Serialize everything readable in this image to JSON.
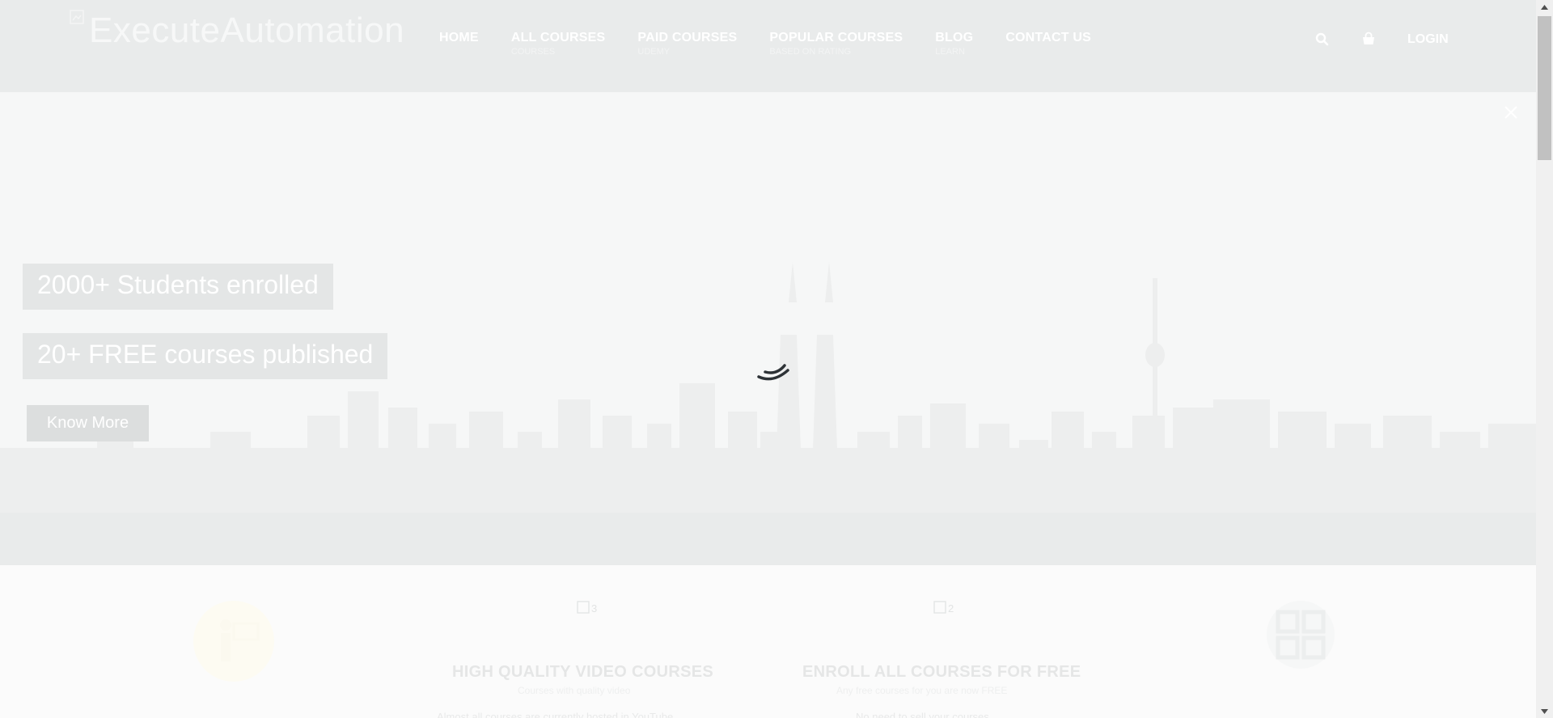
{
  "header": {
    "logo_text": "ExecuteAutomation",
    "nav": [
      {
        "label": "HOME",
        "sub": ""
      },
      {
        "label": "ALL COURSES",
        "sub": "COURSES"
      },
      {
        "label": "PAID COURSES",
        "sub": "UDEMY"
      },
      {
        "label": "POPULAR COURSES",
        "sub": "BASED ON RATING"
      },
      {
        "label": "BLOG",
        "sub": "LEARN"
      },
      {
        "label": "CONTACT US",
        "sub": ""
      }
    ],
    "login_label": "LOGIN",
    "icons": {
      "search": "search-icon",
      "cart": "cart-icon"
    }
  },
  "hero": {
    "badge_students": "2000+ Students enrolled",
    "badge_courses": "20+ FREE courses published",
    "cta_label": "Know More"
  },
  "features": [
    {
      "img_alt": "",
      "title": "",
      "subtitle": "",
      "desc": ""
    },
    {
      "img_alt": "3",
      "title": "HIGH QUALITY VIDEO COURSES",
      "subtitle": "Courses with quality video",
      "desc": "Almost all courses are currently hosted in YouTube"
    },
    {
      "img_alt": "2",
      "title": "ENROLL ALL COURSES FOR FREE",
      "subtitle": "Any free courses for you are now FREE",
      "desc": "No need to sell your courses"
    },
    {
      "img_alt": "",
      "title": "",
      "subtitle": "",
      "desc": ""
    }
  ],
  "colors": {
    "header_bg": "#e9ebeb",
    "hero_bg": "#f5f6f6",
    "spinner": "#2d3236",
    "feature_circle": "#fdfbf2"
  }
}
